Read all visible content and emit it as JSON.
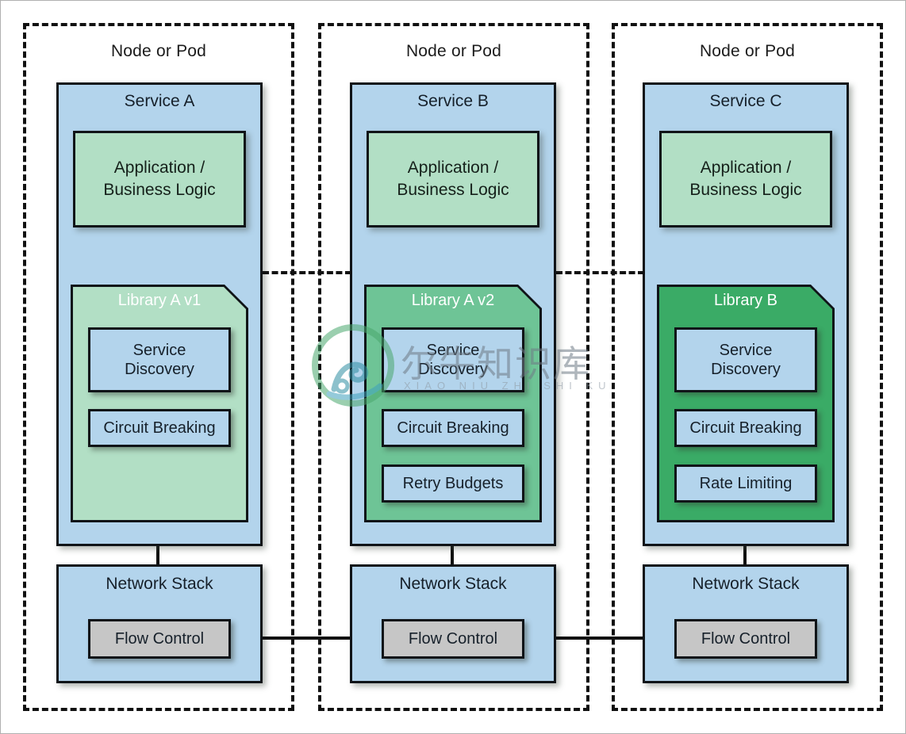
{
  "diagram": {
    "title": "Microservice libraries per node/pod",
    "colors": {
      "service_blue": "#b3d4ec",
      "app_light_green": "#b2dfc5",
      "library_v1_green": "#b2dfc5",
      "library_v2_green": "#6ec496",
      "library_b_green": "#3aab66",
      "flow_control_gray": "#c6c6c6",
      "outline": "#101418",
      "node_frame": "#111111"
    }
  },
  "nodes": [
    {
      "frame_label": "Node or Pod",
      "service": {
        "title": "Service A",
        "app_logic": "Application /\nBusiness Logic",
        "app_logic_line1": "Application /",
        "app_logic_line2": "Business Logic",
        "library": {
          "title": "Library A v1",
          "fill": "#b2dfc5",
          "features": [
            {
              "label_line1": "Service",
              "label_line2": "Discovery",
              "label": "Service Discovery"
            },
            {
              "label_line1": "Circuit Breaking",
              "label_line2": "",
              "label": "Circuit Breaking"
            }
          ]
        }
      },
      "network_stack": {
        "title": "Network Stack",
        "flow_control": "Flow Control"
      }
    },
    {
      "frame_label": "Node or Pod",
      "service": {
        "title": "Service B",
        "app_logic": "Application /\nBusiness Logic",
        "app_logic_line1": "Application /",
        "app_logic_line2": "Business Logic",
        "library": {
          "title": "Library A v2",
          "fill": "#6ec496",
          "features": [
            {
              "label_line1": "Service",
              "label_line2": "Discovery",
              "label": "Service Discovery"
            },
            {
              "label_line1": "Circuit Breaking",
              "label_line2": "",
              "label": "Circuit Breaking"
            },
            {
              "label_line1": "Retry Budgets",
              "label_line2": "",
              "label": "Retry Budgets"
            }
          ]
        }
      },
      "network_stack": {
        "title": "Network Stack",
        "flow_control": "Flow Control"
      }
    },
    {
      "frame_label": "Node or Pod",
      "service": {
        "title": "Service C",
        "app_logic": "Application /\nBusiness Logic",
        "app_logic_line1": "Application /",
        "app_logic_line2": "Business Logic",
        "library": {
          "title": "Library B",
          "fill": "#3aab66",
          "features": [
            {
              "label_line1": "Service",
              "label_line2": "Discovery",
              "label": "Service Discovery"
            },
            {
              "label_line1": "Circuit Breaking",
              "label_line2": "",
              "label": "Circuit Breaking"
            },
            {
              "label_line1": "Rate Limiting",
              "label_line2": "",
              "label": "Rate Limiting"
            }
          ]
        }
      },
      "network_stack": {
        "title": "Network Stack",
        "flow_control": "Flow Control"
      }
    }
  ],
  "watermark": {
    "chinese": "尔牛知识库",
    "latin": "XIAO NIU ZHI SHI KU",
    "logo_icon": "circular-logo-icon"
  }
}
